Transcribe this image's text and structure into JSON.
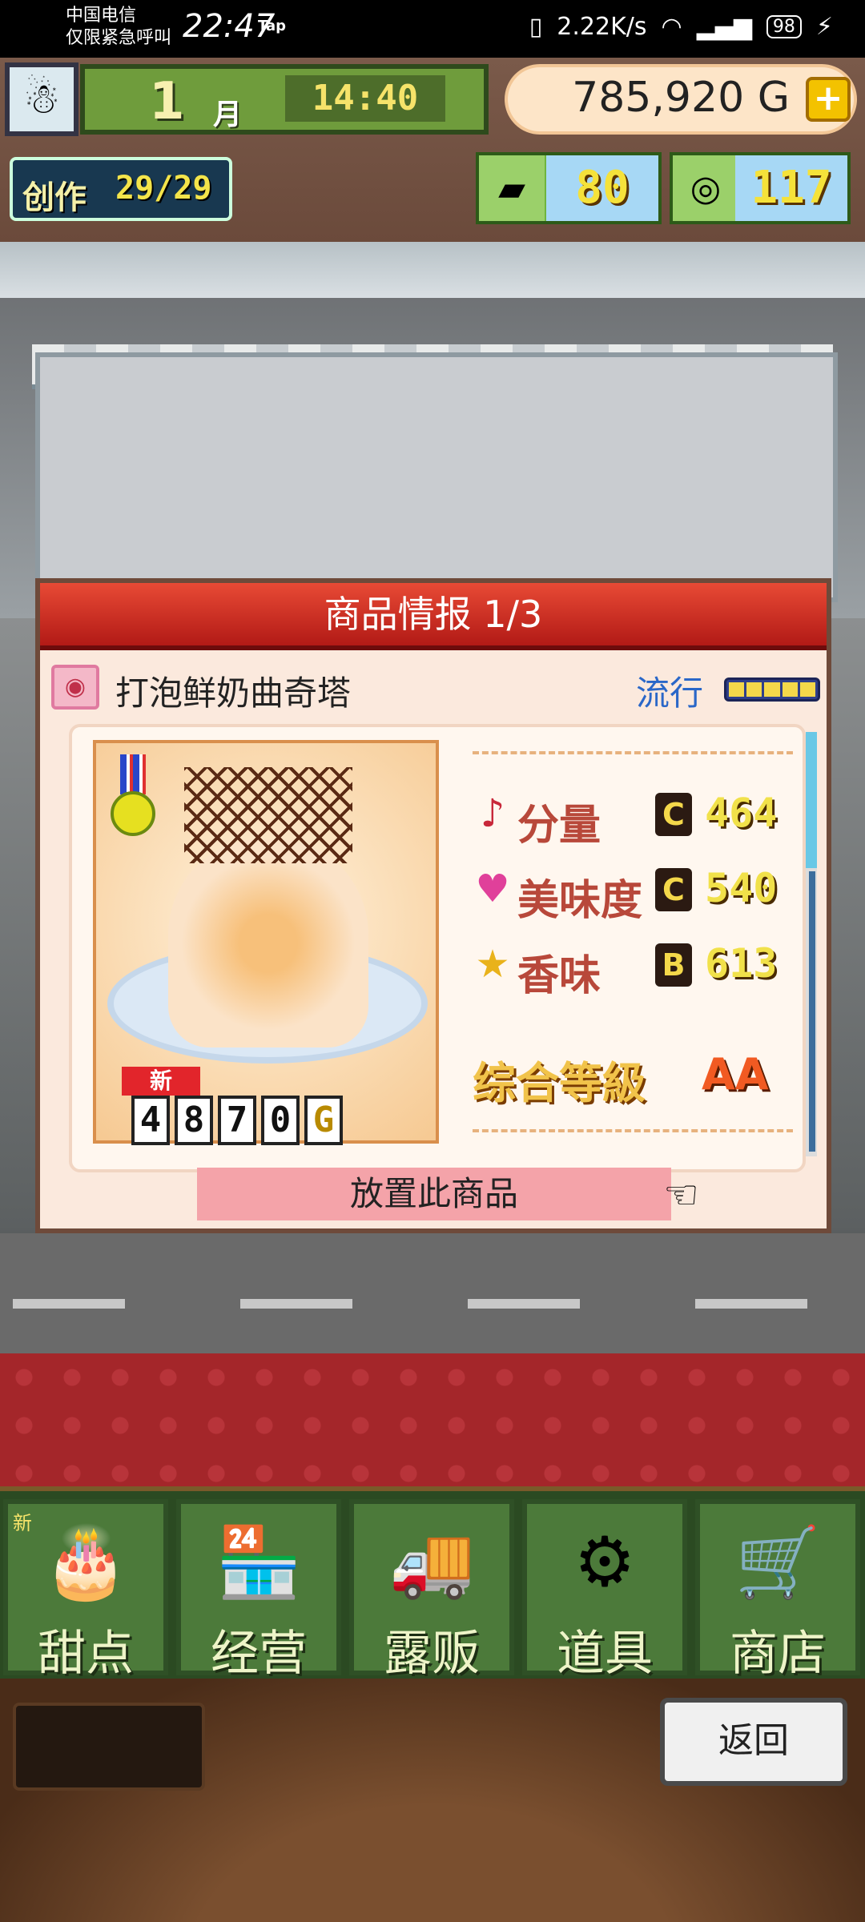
{
  "status_bar": {
    "carrier_line1": "中国电信",
    "carrier_line2": "仅限紧急呼叫",
    "time": "22:47",
    "app_tag": "Tap",
    "net_speed": "2.22K/s",
    "battery": "98"
  },
  "hud": {
    "month_number": "1",
    "month_label": "月",
    "clock": "14:40",
    "money": "785,920",
    "money_unit": "G",
    "creation_label": "创作",
    "creation_value": "29/29",
    "gold_count": "80",
    "coin_count": "117"
  },
  "dialog": {
    "title": "商品情报 1/3",
    "product_name": "打泡鲜奶曲奇塔",
    "trend_label": "流行",
    "trend_level": 5,
    "new_tag": "新",
    "price_digits": [
      "4",
      "8",
      "7",
      "0",
      "G"
    ],
    "stats": [
      {
        "icon": "music-note-icon",
        "name": "分量",
        "grade": "C",
        "value": "464"
      },
      {
        "icon": "heart-icon",
        "name": "美味度",
        "grade": "C",
        "value": "540"
      },
      {
        "icon": "star-icon",
        "name": "香味",
        "grade": "B",
        "value": "613"
      }
    ],
    "overall_label": "综合等級",
    "overall_grade": "AA",
    "place_button": "放置此商品"
  },
  "menu": [
    {
      "label": "甜点",
      "icon": "cake-icon",
      "badge": "新"
    },
    {
      "label": "经营",
      "icon": "shop-building-icon",
      "badge": ""
    },
    {
      "label": "露贩",
      "icon": "food-truck-icon",
      "badge": ""
    },
    {
      "label": "道具",
      "icon": "gear-bag-icon",
      "badge": ""
    },
    {
      "label": "商店",
      "icon": "shopping-cart-icon",
      "badge": ""
    }
  ],
  "back_button": "返回"
}
